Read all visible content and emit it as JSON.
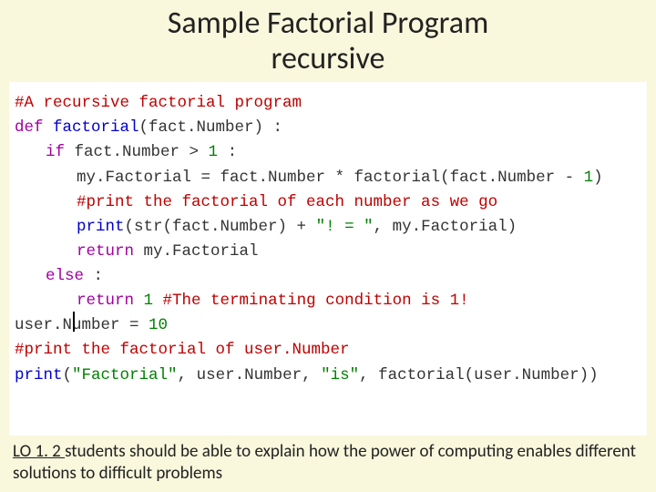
{
  "title_line1": "Sample Factorial Program",
  "title_line2": "recursive",
  "code": {
    "l1": "#A recursive factorial program",
    "l2a": "def ",
    "l2b": "factorial",
    "l2c": "(fact.Number) :",
    "l3a": "if ",
    "l3b": "fact.Number > ",
    "l3c": "1",
    "l3d": " :",
    "l4": "my.Factorial = fact.Number * factorial(fact.Number - ",
    "l4n": "1",
    "l4e": ")",
    "l5": "#print the factorial of each number as we go",
    "l6a": "print",
    "l6b": "(str(fact.Number) + ",
    "l6c": "\"! = \"",
    "l6d": ", my.Factorial)",
    "l7a": "return ",
    "l7b": "my.Factorial",
    "l8a": "else ",
    "l8b": ":",
    "l9a": "return ",
    "l9b": "1",
    "l9c": "   ",
    "l9d": "#The terminating condition is 1!",
    "l10a": "user.Number = ",
    "l10b": "10",
    "l11": "#print the factorial of user.Number",
    "l12a": "print",
    "l12b": "(",
    "l12c": "\"Factorial\"",
    "l12d": ", user.Number, ",
    "l12e": "\"is\"",
    "l12f": ", factorial(user.Number))"
  },
  "caption": {
    "lo": "LO 1. 2 ",
    "rest": "students should be able to explain how the power of computing enables different solutions to difficult problems"
  }
}
